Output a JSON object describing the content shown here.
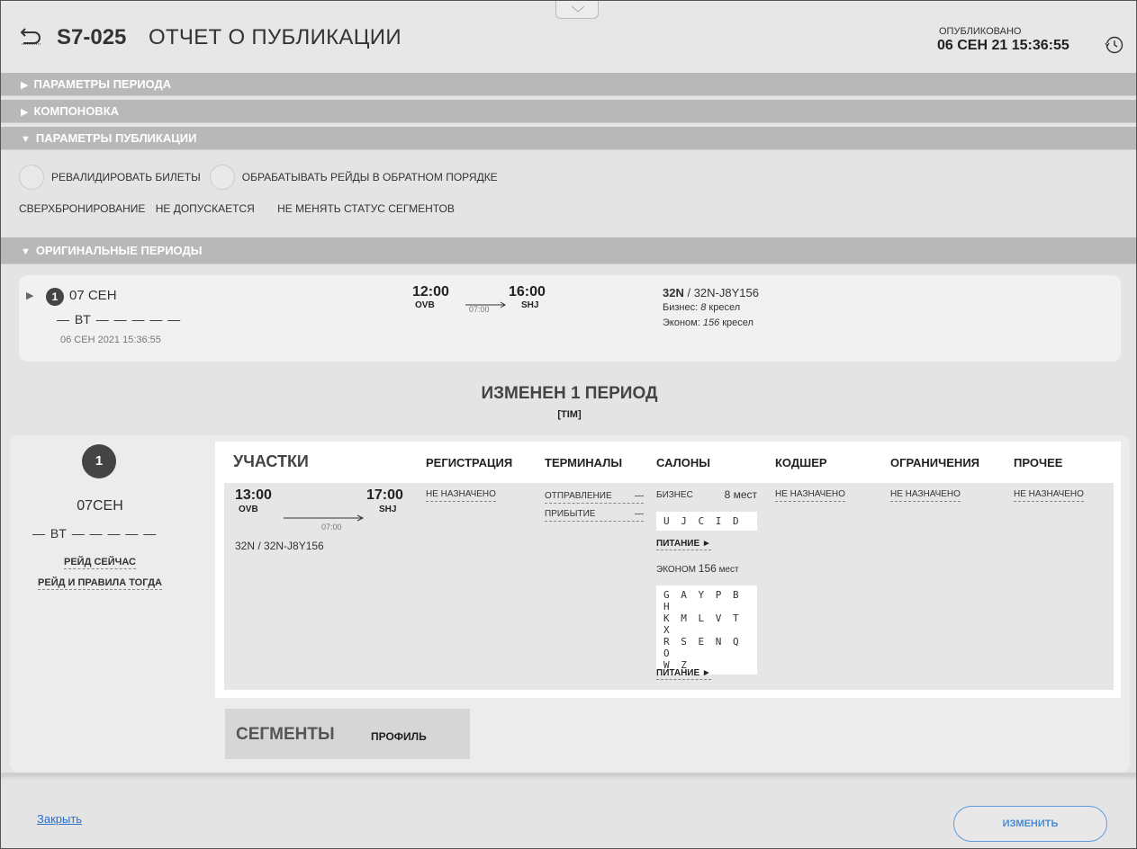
{
  "header": {
    "code": "S7-025",
    "title": "ОТЧЕТ О ПУБЛИКАЦИИ",
    "published_label": "ОПУБЛИКОВАНО",
    "published_date": "06 СЕН 21 15:36:55"
  },
  "sections": {
    "period_params": "ПАРАМЕТРЫ ПЕРИОДА",
    "layout": "КОМПОНОВКА",
    "pub_params": "ПАРАМЕТРЫ ПУБЛИКАЦИИ",
    "original_periods": "ОРИГИНАЛЬНЫЕ ПЕРИОДЫ"
  },
  "pub_options": {
    "revalidate": "РЕВАЛИДИРОВАТЬ БИЛЕТЫ",
    "reverse": "ОБРАБАТЫВАТЬ РЕЙДЫ В ОБРАТНОМ ПОРЯДКЕ",
    "overbooking_label": "СВЕРХБРОНИРОВАНИЕ",
    "overbooking_value": "НЕ ДОПУСКАЕТСЯ",
    "segment_status": "НЕ МЕНЯТЬ СТАТУС СЕГМЕНТОВ"
  },
  "original_period": {
    "num": "1",
    "date": "07 СЕН",
    "days": "— ВТ — — — — —",
    "stamp": "06 СЕН 2021 15:36:55",
    "dep_time": "12:00",
    "dep_code": "OVB",
    "duration": "07:00",
    "arr_time": "16:00",
    "arr_code": "SHJ",
    "aircraft_bold": "32N",
    "aircraft_rest": " / 32N-J8Y156",
    "business_prefix": "Бизнес: ",
    "business_count": "8",
    "business_suffix": " кресел",
    "economy_prefix": "Эконом: ",
    "economy_count": "156",
    "economy_suffix": " кресел"
  },
  "changed": {
    "title": "ИЗМЕНЕН 1 ПЕРИОД",
    "subtitle": "[TIM]",
    "num": "1",
    "date": "07СЕН",
    "days": "— ВТ — — — — —",
    "link_now": "РЕЙД СЕЙЧАС",
    "link_then": "РЕЙД И ПРАВИЛА ТОГДА",
    "columns": {
      "legs": "УЧАСТКИ",
      "checkin": "РЕГИСТРАЦИЯ",
      "terminals": "ТЕРМИНАЛЫ",
      "salons": "САЛОНЫ",
      "codeshare": "КОДШЕР",
      "restrictions": "ОГРАНИЧЕНИЯ",
      "other": "ПРОЧЕЕ"
    },
    "leg": {
      "dep_time": "13:00",
      "dep_code": "OVB",
      "duration": "07:00",
      "arr_time": "17:00",
      "arr_code": "SHJ",
      "aircraft": "32N / 32N-J8Y156"
    },
    "checkin_value": "НЕ НАЗНАЧЕНО",
    "terminal_dep": "ОТПРАВЛЕНИЕ",
    "terminal_arr": "ПРИБЫТИЕ",
    "terminal_dash": "—",
    "business_label": "БИЗНЕС",
    "business_seats": "8 мест",
    "business_classes": "U J C I D",
    "meal_label": "ПИТАНИЕ ►",
    "economy_label": "ЭКОНОМ",
    "economy_seats": "156",
    "economy_unit": " мест",
    "economy_classes_1": "G A Y P B H",
    "economy_classes_2": "K M L V T X",
    "economy_classes_3": "R S E N Q O",
    "economy_classes_4": "W Z",
    "codeshare_value": "НЕ НАЗНАЧЕНО",
    "restrictions_value": "НЕ НАЗНАЧЕНО",
    "other_value": "НЕ НАЗНАЧЕНО"
  },
  "segments": {
    "title": "СЕГМЕНТЫ",
    "profile": "ПРОФИЛЬ"
  },
  "footer": {
    "close": "Закрыть",
    "change": "ИЗМЕНИТЬ"
  },
  "colors": {
    "section_bar": "#b8b8b8",
    "link": "#2a6fd0",
    "button_border": "#5d9be0"
  }
}
